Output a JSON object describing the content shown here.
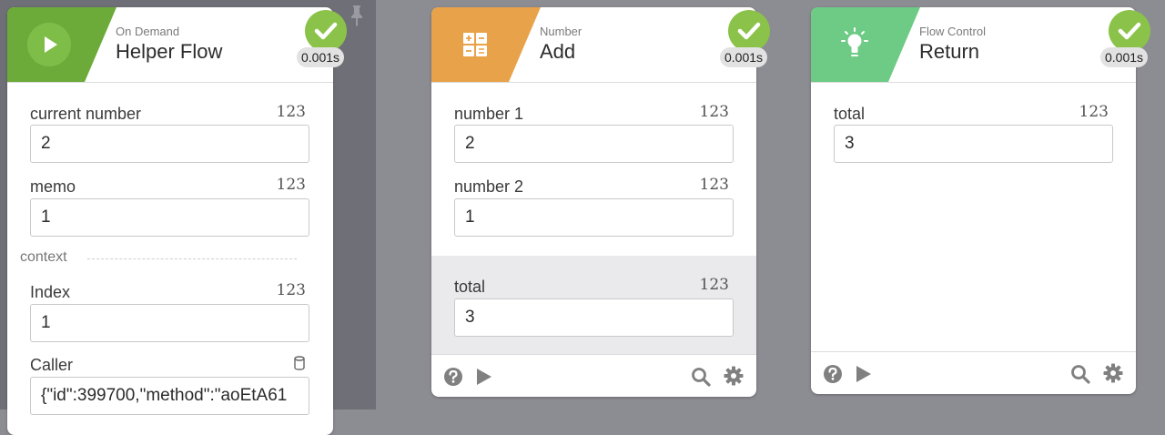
{
  "colors": {
    "on_demand": "#6cab3a",
    "number": "#e8a24a",
    "flow_control": "#6dcb85",
    "success": "#8bc34a",
    "canvas_left": "#6f6f77",
    "canvas_right": "#8c8c93"
  },
  "cards": [
    {
      "category": "On Demand",
      "title": "Helper Flow",
      "icon": "play-icon",
      "status": "success",
      "time": "0.001s",
      "pinned": true,
      "inputs": [
        {
          "label": "current number",
          "type": "123",
          "value": "2"
        },
        {
          "label": "memo",
          "type": "123",
          "value": "1"
        }
      ],
      "context_label": "context",
      "context_inputs": [
        {
          "label": "Index",
          "type": "123",
          "value": "1"
        },
        {
          "label": "Caller",
          "type": "database-icon",
          "value": "{\"id\":399700,\"method\":\"aoEtA61"
        }
      ]
    },
    {
      "category": "Number",
      "title": "Add",
      "icon": "calculator-icon",
      "status": "success",
      "time": "0.001s",
      "inputs": [
        {
          "label": "number 1",
          "type": "123",
          "value": "2"
        },
        {
          "label": "number 2",
          "type": "123",
          "value": "1"
        }
      ],
      "outputs": [
        {
          "label": "total",
          "type": "123",
          "value": "3"
        }
      ],
      "footer_icons": [
        "help-icon",
        "play-icon",
        "search-icon",
        "gear-icon"
      ]
    },
    {
      "category": "Flow Control",
      "title": "Return",
      "icon": "lightbulb-icon",
      "status": "success",
      "time": "0.001s",
      "inputs": [
        {
          "label": "total",
          "type": "123",
          "value": "3"
        }
      ],
      "footer_icons": [
        "help-icon",
        "play-icon",
        "search-icon",
        "gear-icon"
      ]
    }
  ]
}
